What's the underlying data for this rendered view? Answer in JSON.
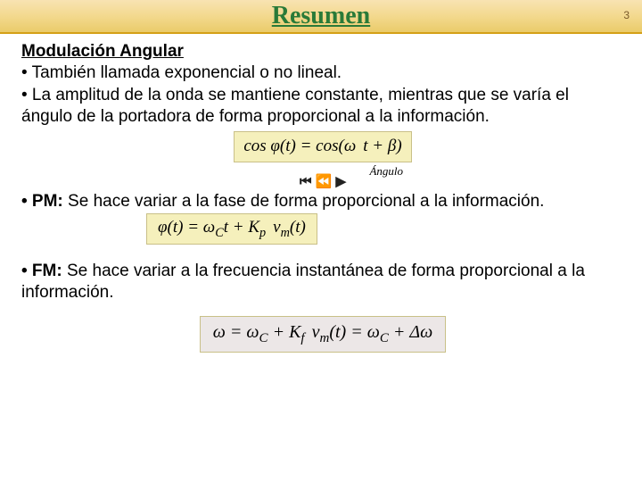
{
  "header": {
    "title": "Resumen",
    "page_number": "3"
  },
  "section": {
    "heading": "Modulación Angular",
    "bullet1": "• También llamada exponencial o no lineal.",
    "bullet2": "• La amplitud de la onda se mantiene constante, mientras que se varía el ángulo de la portadora de forma proporcional a la información."
  },
  "eq1": {
    "formula": "cos φ(t) = cos(ω t + β)",
    "label": "Ángulo",
    "controls": "⏮ ⏪ ▶"
  },
  "pm": {
    "label": "• PM:",
    "text": " Se hace variar a la fase de forma proporcional a la información."
  },
  "eq2": {
    "formula_html": "φ(t) = ω<sub>C</sub> t + K<sub>p</sub> v<sub>m</sub>(t)"
  },
  "fm": {
    "label": "• FM:",
    "text": " Se hace variar a la frecuencia instantánea de forma proporcional a la información."
  },
  "eq3": {
    "formula_html": "ω = ω<sub>C</sub> + K<sub>f</sub> v<sub>m</sub>(t) = ω<sub>C</sub> + Δω"
  }
}
